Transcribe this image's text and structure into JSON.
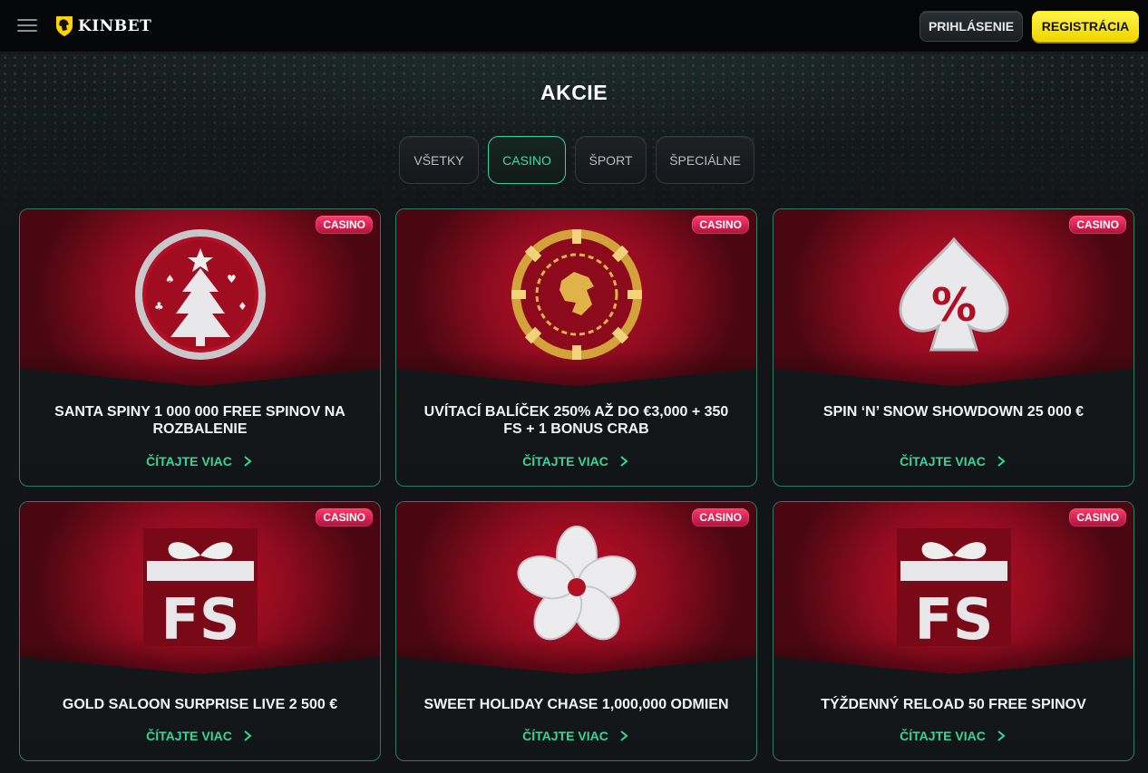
{
  "header": {
    "brand": "KINBET",
    "login_label": "PRIHLÁSENIE",
    "register_label": "REGISTRÁCIA"
  },
  "page": {
    "title": "AKCIE"
  },
  "tabs": [
    {
      "label": "VŠETKY",
      "active": false
    },
    {
      "label": "CASINO",
      "active": true
    },
    {
      "label": "ŠPORT",
      "active": false
    },
    {
      "label": "ŠPECIÁLNE",
      "active": false
    }
  ],
  "promotions": [
    {
      "badge": "CASINO",
      "title": "SANTA SPINY 1 000 000 FREE SPINOV NA ROZBALENIE",
      "link": "ČÍTAJTE VIAC",
      "icon": "christmas-tree-coin-icon"
    },
    {
      "badge": "CASINO",
      "title": "UVÍTACÍ BALÍČEK 250% AŽ DO €3,000 + 350 FS + 1 BONUS CRAB",
      "link": "ČÍTAJTE VIAC",
      "icon": "lion-chip-icon"
    },
    {
      "badge": "CASINO",
      "title": "SPIN ‘N’ SNOW SHOWDOWN 25 000 €",
      "link": "ČÍTAJTE VIAC",
      "icon": "spade-percent-icon"
    },
    {
      "badge": "CASINO",
      "title": "GOLD SALOON SURPRISE LIVE 2 500 €",
      "link": "ČÍTAJTE VIAC",
      "icon": "fs-gift-icon"
    },
    {
      "badge": "CASINO",
      "title": "SWEET HOLIDAY CHASE 1,000,000 ODMIEN",
      "link": "ČÍTAJTE VIAC",
      "icon": "flower-icon"
    },
    {
      "badge": "CASINO",
      "title": "TÝŽDENNÝ RELOAD 50 FREE SPINOV",
      "link": "ČÍTAJTE VIAC",
      "icon": "fs-gift-icon"
    }
  ],
  "colors": {
    "accent": "#35d79a",
    "register": "#f5e100",
    "badge": "#e8285a",
    "card_art": "#b50f27"
  }
}
